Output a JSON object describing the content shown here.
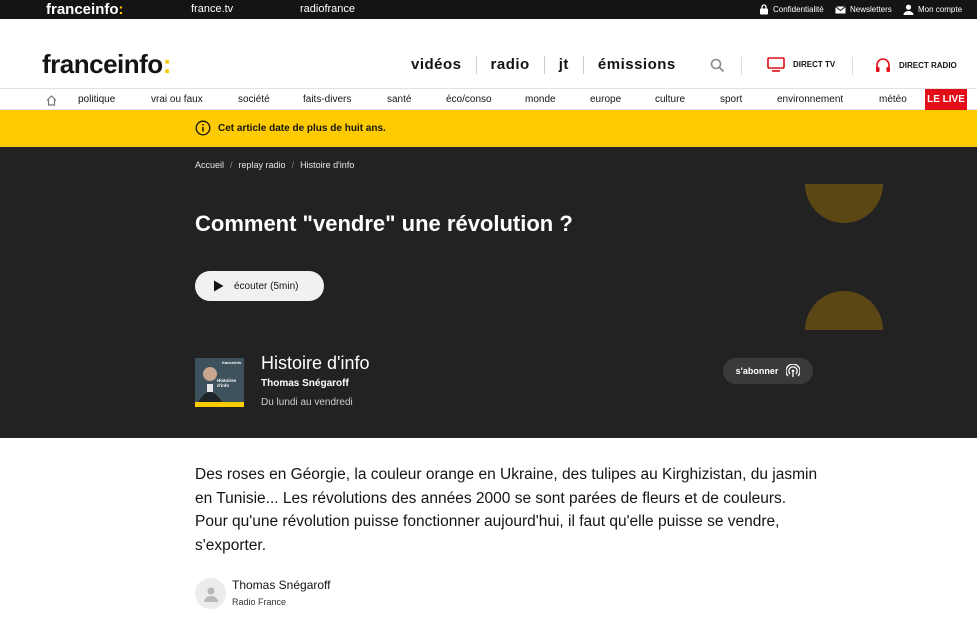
{
  "topbar": {
    "brand": "franceinfo",
    "brand_colon": ":",
    "links": [
      "france.tv",
      "radiofrance"
    ],
    "privacy": "Confidentialité",
    "newsletters": "Newsletters",
    "account": "Mon compte"
  },
  "header": {
    "logo": "franceinfo",
    "logo_colon": ":",
    "nav": [
      "vidéos",
      "radio",
      "jt",
      "émissions"
    ],
    "direct_tv": "DIRECT TV",
    "direct_radio": "DIRECT RADIO"
  },
  "subnav": {
    "categories": [
      "politique",
      "vrai ou faux",
      "société",
      "faits-divers",
      "santé",
      "éco/conso",
      "monde",
      "europe",
      "culture",
      "sport",
      "environnement",
      "météo"
    ],
    "live": "LE LIVE"
  },
  "warning": {
    "text": "Cet article date de plus de huit ans."
  },
  "hero": {
    "breadcrumb": [
      "Accueil",
      "replay radio",
      "Histoire d'info"
    ],
    "title": "Comment \"vendre\" une révolution ?",
    "listen_label": "écouter (5min)",
    "show": {
      "thumb_brand": "franceinfo",
      "thumb_title": "Histoires d'info",
      "title": "Histoire d'info",
      "host": "Thomas Snégaroff",
      "schedule": "Du lundi au vendredi"
    },
    "subscribe_label": "s'abonner",
    "colors": {
      "background": "#222222",
      "accent": "#5a4714"
    }
  },
  "article": {
    "chapo": "Des roses en Géorgie, la couleur orange en Ukraine, des tulipes au Kirghizistan, du jasmin en Tunisie... Les révolutions des années 2000 se sont parées de fleurs et de couleurs. Pour qu'une révolution puisse fonctionner aujourd'hui, il faut qu'elle puisse se vendre, s'exporter.",
    "author_name": "Thomas Snégaroff",
    "author_org": "Radio France"
  },
  "colors": {
    "brand_yellow": "#fecb00",
    "live_red": "#e20d17",
    "dark": "#141414"
  },
  "icons": [
    "lock-icon",
    "mail-icon",
    "user-icon",
    "search-icon",
    "tv-icon",
    "headphones-icon",
    "home-icon",
    "info-icon",
    "play-icon",
    "podcast-icon",
    "avatar-icon"
  ]
}
